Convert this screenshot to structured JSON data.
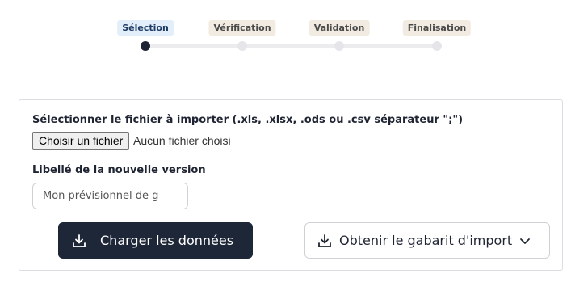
{
  "stepper": {
    "steps": [
      {
        "label": "Sélection",
        "state": "active"
      },
      {
        "label": "Vérification",
        "state": "pending"
      },
      {
        "label": "Validation",
        "state": "pending"
      },
      {
        "label": "Finalisation",
        "state": "pending"
      }
    ]
  },
  "form": {
    "file_label": "Sélectionner le fichier à importer (.xls, .xlsx, .ods ou .csv séparateur \";\")",
    "file_button": "Choisir un fichier",
    "file_status": "Aucun fichier choisi",
    "version_label": "Libellé de la nouvelle version",
    "version_placeholder": "Mon prévisionnel de g"
  },
  "actions": {
    "load_label": "Charger les données",
    "load_icon": "download-icon",
    "template_label": "Obtenir le gabarit d'import",
    "template_icon": "download-icon",
    "template_chevron": "chevron-down-icon"
  },
  "colors": {
    "primary": "#1e2738",
    "active_step_bg": "#e2eefa",
    "pending_step_bg": "#f1ebe1"
  }
}
